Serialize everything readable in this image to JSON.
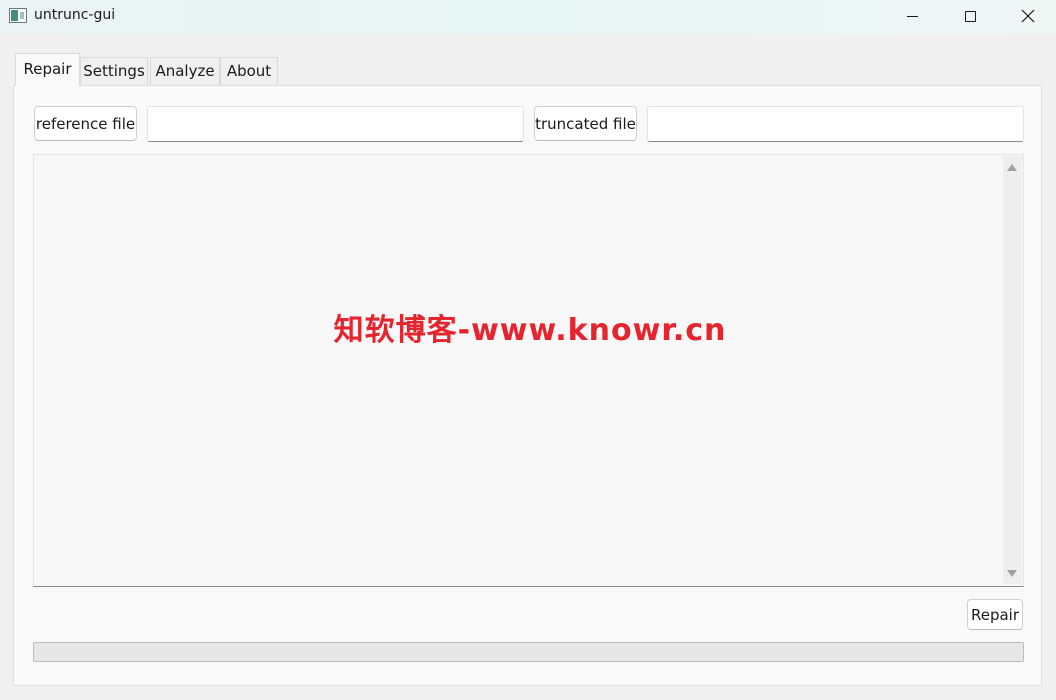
{
  "window": {
    "title": "untrunc-gui",
    "icons": {
      "app": "app-window-icon",
      "minimize": "minimize-icon",
      "maximize": "maximize-icon",
      "close": "close-icon"
    }
  },
  "tabs": [
    {
      "label": "Repair",
      "active": true
    },
    {
      "label": "Settings",
      "active": false
    },
    {
      "label": "Analyze",
      "active": false
    },
    {
      "label": "About",
      "active": false
    }
  ],
  "repair": {
    "reference_button": "reference file",
    "reference_value": "",
    "truncated_button": "truncated file",
    "truncated_value": "",
    "log_text": "",
    "repair_button": "Repair",
    "progress": 0
  },
  "watermark": "知软博客-www.knowr.cn",
  "colors": {
    "watermark": "#e6242d",
    "panel_bg": "#f9f9f9",
    "window_bg": "#f0f0f0"
  }
}
